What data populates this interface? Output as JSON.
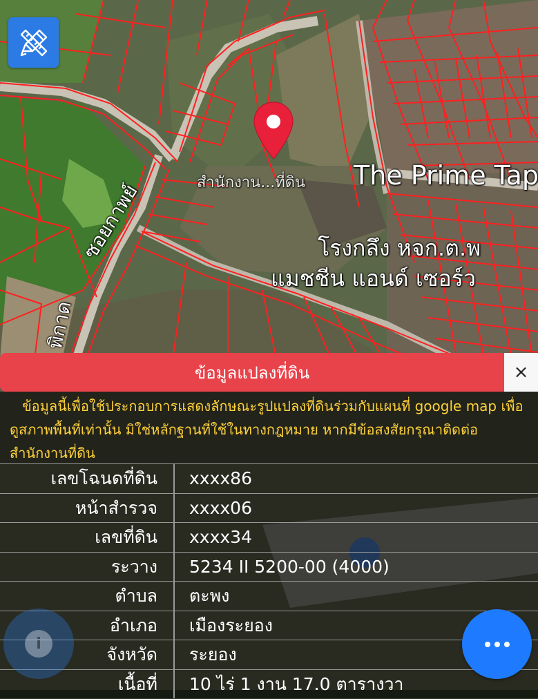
{
  "map": {
    "pin_label": "สำนักงาน...ที่ดิน",
    "place_label_1": "The Prime Tap",
    "place_label_2_line1": "โรงกลึง หจก.ต.พ",
    "place_label_2_line2": "แมชชีน แอนด์ เซอร์ว",
    "road_label": "ซอยกาพย์",
    "road_label_2": "พิกาด",
    "colors": {
      "parcel_line": "#ff2020",
      "pin": "#e8203a"
    }
  },
  "toolbar": {
    "draw_icon": "pencil-ruler-icon"
  },
  "panel": {
    "title": "ข้อมูลแปลงที่ดิน",
    "close_label": "×",
    "disclaimer": "ข้อมูลนี้เพื่อใช้ประกอบการแสดงลักษณะรูปแปลงที่ดินร่วมกับแผนที่ google map เพื่อดูสภาพพื้นที่เท่านั้น มิใช่หลักฐานที่ใช้ในทางกฎหมาย หากมีข้อสงสัยกรุณาติดต่อสำนักงานที่ดิน",
    "rows": [
      {
        "label": "เลขโฉนดที่ดิน",
        "value": "xxxx86"
      },
      {
        "label": "หน้าสำรวจ",
        "value": "xxxx06"
      },
      {
        "label": "เลขที่ดิน",
        "value": "xxxx34"
      },
      {
        "label": "ระวาง",
        "value": "5234 II 5200-00 (4000)"
      },
      {
        "label": "ตำบล",
        "value": "ตะพง"
      },
      {
        "label": "อำเภอ",
        "value": "เมืองระยอง"
      },
      {
        "label": "จังหวัด",
        "value": "ระยอง"
      },
      {
        "label": "เนื้อที่",
        "value": "10 ไร่ 1 งาน 17.0 ตารางวา"
      }
    ],
    "colors": {
      "header": "#e8424a",
      "disclaimer_text": "#ffd23a"
    }
  },
  "fab": {
    "icon": "more-dots-icon"
  },
  "info_button": {
    "icon": "info-icon",
    "label": "i"
  }
}
